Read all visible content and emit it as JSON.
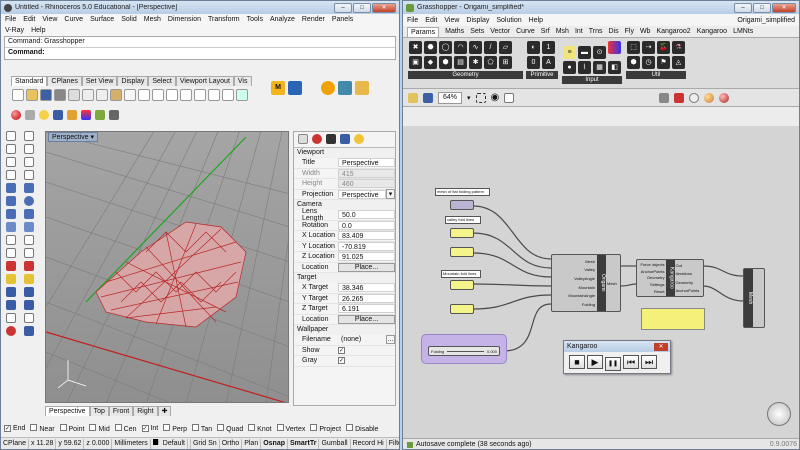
{
  "rhino": {
    "title": "Untitled - Rhinoceros 5.0 Educational - [Perspective]",
    "menu": [
      "File",
      "Edit",
      "View",
      "Curve",
      "Surface",
      "Solid",
      "Mesh",
      "Dimension",
      "Transform",
      "Tools",
      "Analyze",
      "Render",
      "Panels"
    ],
    "menu2": [
      "V-Ray",
      "Help"
    ],
    "command_history": "Command: Grasshopper",
    "command_prompt": "Command:",
    "toolbar_tabs": [
      "Standard",
      "CPlanes",
      "Set View",
      "Display",
      "Select",
      "Viewport Layout",
      "Vis"
    ],
    "viewport_label": "Perspective",
    "view_tabs": [
      "Perspective",
      "Top",
      "Front",
      "Right"
    ],
    "props": {
      "viewport_header": "Viewport",
      "title_k": "Title",
      "title_v": "Perspective",
      "width_k": "Width",
      "width_v": "415",
      "height_k": "Height",
      "height_v": "460",
      "projection_k": "Projection",
      "projection_v": "Perspective",
      "camera_header": "Camera",
      "lens_k": "Lens Length",
      "lens_v": "50.0",
      "rotation_k": "Rotation",
      "rotation_v": "0.0",
      "xloc_k": "X Location",
      "xloc_v": "83.409",
      "yloc_k": "Y Location",
      "yloc_v": "-70.819",
      "zloc_k": "Z Location",
      "zloc_v": "91.025",
      "loc_k": "Location",
      "place_label": "Place...",
      "target_header": "Target",
      "xt_k": "X Target",
      "xt_v": "38.346",
      "yt_k": "Y Target",
      "yt_v": "26.265",
      "zt_k": "Z Target",
      "zt_v": "6.191",
      "tloc_k": "Location",
      "tplace_label": "Place...",
      "wallpaper_header": "Wallpaper",
      "file_k": "Filename",
      "file_v": "(none)",
      "show_k": "Show",
      "gray_k": "Gray"
    },
    "osnaps": [
      "End",
      "Near",
      "Point",
      "Mid",
      "Cen",
      "Int",
      "Perp",
      "Tan",
      "Quad",
      "Knot",
      "Vertex",
      "Project",
      "Disable"
    ],
    "status": [
      "CPlane",
      "x 11.28",
      "y 59.62",
      "z 0.000",
      "Millimeters",
      "Default",
      "Grid Sn",
      "Ortho",
      "Plan",
      "Osnap",
      "SmartTr",
      "Gumball",
      "Record Hi",
      "Filter"
    ]
  },
  "gh": {
    "title": "Grasshopper - Origami_simplified*",
    "menu": [
      "File",
      "Edit",
      "View",
      "Display",
      "Solution",
      "Help"
    ],
    "doc_name": "Origami_simplified",
    "tabs": [
      "Params",
      "Maths",
      "Sets",
      "Vector",
      "Curve",
      "Srf",
      "Msh",
      "Int",
      "Trns",
      "Dis",
      "Fly",
      "Wb",
      "Kangaroo2",
      "Kangaroo",
      "LMNts"
    ],
    "groups": [
      "Geometry",
      "Primitive",
      "Input",
      "Util"
    ],
    "zoom": "64%",
    "panel_labels": [
      "mesh of flat folding pattern",
      "valley fold lines",
      "Mountain fold lines"
    ],
    "origami_inputs": [
      "Mesh",
      "Valley",
      "ValleyAngle",
      "Mountain",
      "MountainAngle",
      "Folding"
    ],
    "origami_name": "Origami",
    "kangaroo_inputs": [
      "Force objects",
      "AnchorPoints",
      "Geometry",
      "Settings",
      "Reset"
    ],
    "kangaroo_outputs": [
      "Out",
      "Iterations",
      "Geometry",
      "AnchorPoints"
    ],
    "kangaroo_name": "Kangaroo",
    "mesh_node": "Mesh",
    "slider_name": "Folding",
    "slider_value": "0.000",
    "kangaroo_panel": {
      "title": "Kangaroo",
      "buttons": [
        "■",
        "▶",
        "❚❚",
        "⏮",
        "⏭"
      ]
    },
    "status": "Autosave complete (38 seconds ago)",
    "version": "0.9.0076"
  }
}
